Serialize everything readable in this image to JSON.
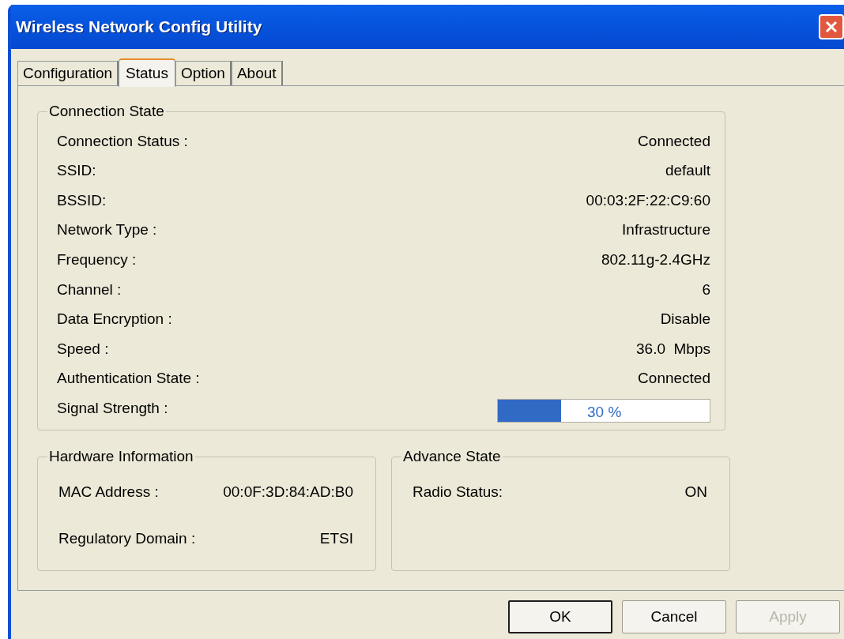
{
  "window": {
    "title": "Wireless Network Config Utility"
  },
  "tabs": [
    {
      "label": "Configuration",
      "selected": false
    },
    {
      "label": "Status",
      "selected": true
    },
    {
      "label": "Option",
      "selected": false
    },
    {
      "label": "About",
      "selected": false
    }
  ],
  "connection_state": {
    "title": "Connection State",
    "rows": [
      {
        "kind": "text",
        "label": "Connection Status :",
        "value": "Connected"
      },
      {
        "kind": "text",
        "label": "SSID:",
        "value": "default"
      },
      {
        "kind": "text",
        "label": "BSSID:",
        "value": "00:03:2F:22:C9:60"
      },
      {
        "kind": "text",
        "label": "Network Type :",
        "value": "Infrastructure"
      },
      {
        "kind": "text",
        "label": "Frequency :",
        "value": "802.11g-2.4GHz"
      },
      {
        "kind": "text",
        "label": "Channel :",
        "value": "6"
      },
      {
        "kind": "text",
        "label": "Data Encryption :",
        "value": "Disable"
      },
      {
        "kind": "text",
        "label": "Speed :",
        "value": "36.0  Mbps"
      },
      {
        "kind": "text",
        "label": "Authentication State :",
        "value": "Connected"
      },
      {
        "kind": "meter",
        "label": "Signal Strength :",
        "value": "30 %",
        "level": 0.3
      }
    ]
  },
  "hardware_information": {
    "title": "Hardware Information",
    "rows": [
      {
        "label": "MAC Address :",
        "value": "00:0F:3D:84:AD:B0"
      },
      {
        "label": "Regulatory Domain :",
        "value": "ETSI"
      }
    ]
  },
  "advance_state": {
    "title": "Advance State",
    "rows": [
      {
        "label": "Radio Status:",
        "value": "ON"
      }
    ]
  },
  "buttons": [
    {
      "label": "OK",
      "default": true,
      "disabled": false
    },
    {
      "label": "Cancel",
      "default": false,
      "disabled": false
    },
    {
      "label": "Apply",
      "default": false,
      "disabled": true
    }
  ]
}
